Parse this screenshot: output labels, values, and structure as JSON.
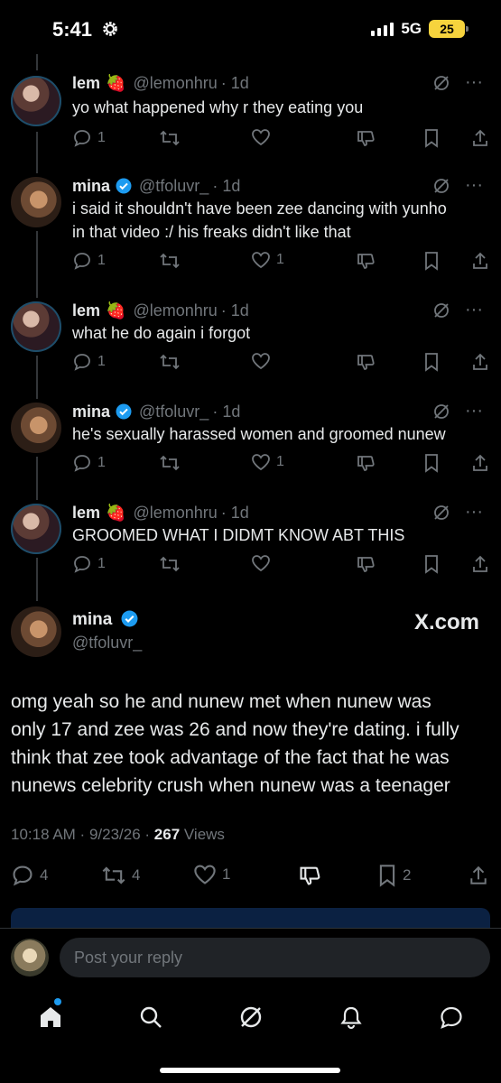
{
  "status_bar": {
    "time": "5:41",
    "network": "5G",
    "battery": "25"
  },
  "replies": [
    {
      "author": "lem",
      "emoji": "🍓",
      "handle": "@lemonhru",
      "time": "· 1d",
      "text": [
        "yo what happened why r they eating you"
      ],
      "counts": {
        "reply": "1",
        "retweet": "",
        "like": ""
      }
    },
    {
      "author": "mina",
      "verified": true,
      "handle": "@tfoluvr_",
      "time": "· 1d",
      "text": [
        "i said it shouldn't have been zee dancing with yunho",
        "in that video :/ his freaks didn't like that"
      ],
      "counts": {
        "reply": "1",
        "retweet": "",
        "like": "1"
      }
    },
    {
      "author": "lem",
      "emoji": "🍓",
      "handle": "@lemonhru",
      "time": "· 1d",
      "text": [
        "what he do again i forgot"
      ],
      "counts": {
        "reply": "1",
        "retweet": "",
        "like": ""
      }
    },
    {
      "author": "mina",
      "verified": true,
      "handle": "@tfoluvr_",
      "time": "· 1d",
      "text": [
        "he's sexually harassed women and groomed nunew"
      ],
      "counts": {
        "reply": "1",
        "retweet": "",
        "like": "1"
      }
    },
    {
      "author": "lem",
      "emoji": "🍓",
      "handle": "@lemonhru",
      "time": "· 1d",
      "text": [
        "GROOMED WHAT I DIDMT KNOW ABT THIS"
      ],
      "counts": {
        "reply": "1",
        "retweet": "",
        "like": ""
      }
    }
  ],
  "main_tweet": {
    "author": "mina",
    "handle": "@tfoluvr_",
    "watermark": "X.com",
    "text": [
      "omg yeah so he and nunew met when nunew was",
      "only 17 and zee was 26 and now they're dating. i fully",
      "think that zee took advantage of the fact that he was",
      "nunews celebrity crush when nunew was a teenager"
    ],
    "time": "10:18 AM",
    "date": "9/23/26",
    "views_count": "267",
    "views_label": "Views",
    "counts": {
      "reply": "4",
      "retweet": "4",
      "like": "1",
      "bookmark": "2"
    }
  },
  "reply_box": {
    "placeholder": "Post your reply"
  },
  "icons": {
    "reply": "reply-icon",
    "retweet": "retweet-icon",
    "like": "heart-icon",
    "dislike": "dislike-icon",
    "bookmark": "bookmark-icon",
    "share": "share-icon",
    "grok": "grok-icon",
    "more": "more-icon"
  },
  "colors": {
    "background": "#000000",
    "text": "#e7e9ea",
    "muted": "#71767b",
    "verified": "#1d9bf0",
    "battery": "#f6d33d"
  }
}
